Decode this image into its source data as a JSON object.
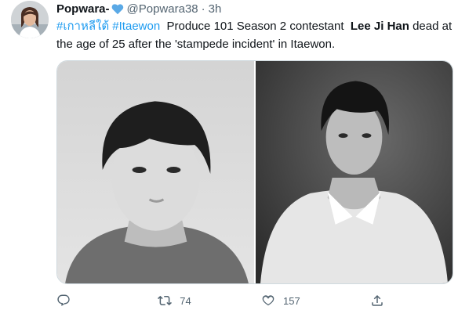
{
  "tweet": {
    "display_name": "Popwara-",
    "handle": "@Popwara38",
    "separator": "·",
    "time": "3h",
    "hashtags": [
      "#เกาหลีใต้",
      "#Itaewon"
    ],
    "text_part1": "Produce 101 Season 2 contestant",
    "text_bold": "Lee Ji Han",
    "text_part2": "dead at the age of 25 after the 'stampede incident' in Itaewon."
  },
  "media": {
    "photos": [
      {
        "name": "left-portrait"
      },
      {
        "name": "right-portrait"
      }
    ]
  },
  "actions": {
    "reply_count": "",
    "retweet_count": "74",
    "like_count": "157",
    "share_count": ""
  },
  "icons": {
    "name_badge": "blue-heart-icon",
    "reply": "reply-icon",
    "retweet": "retweet-icon",
    "like": "like-icon",
    "share": "share-icon"
  },
  "colors": {
    "link": "#1d9bf0",
    "heart": "#5aa9e6",
    "secondary_text": "#536471"
  }
}
